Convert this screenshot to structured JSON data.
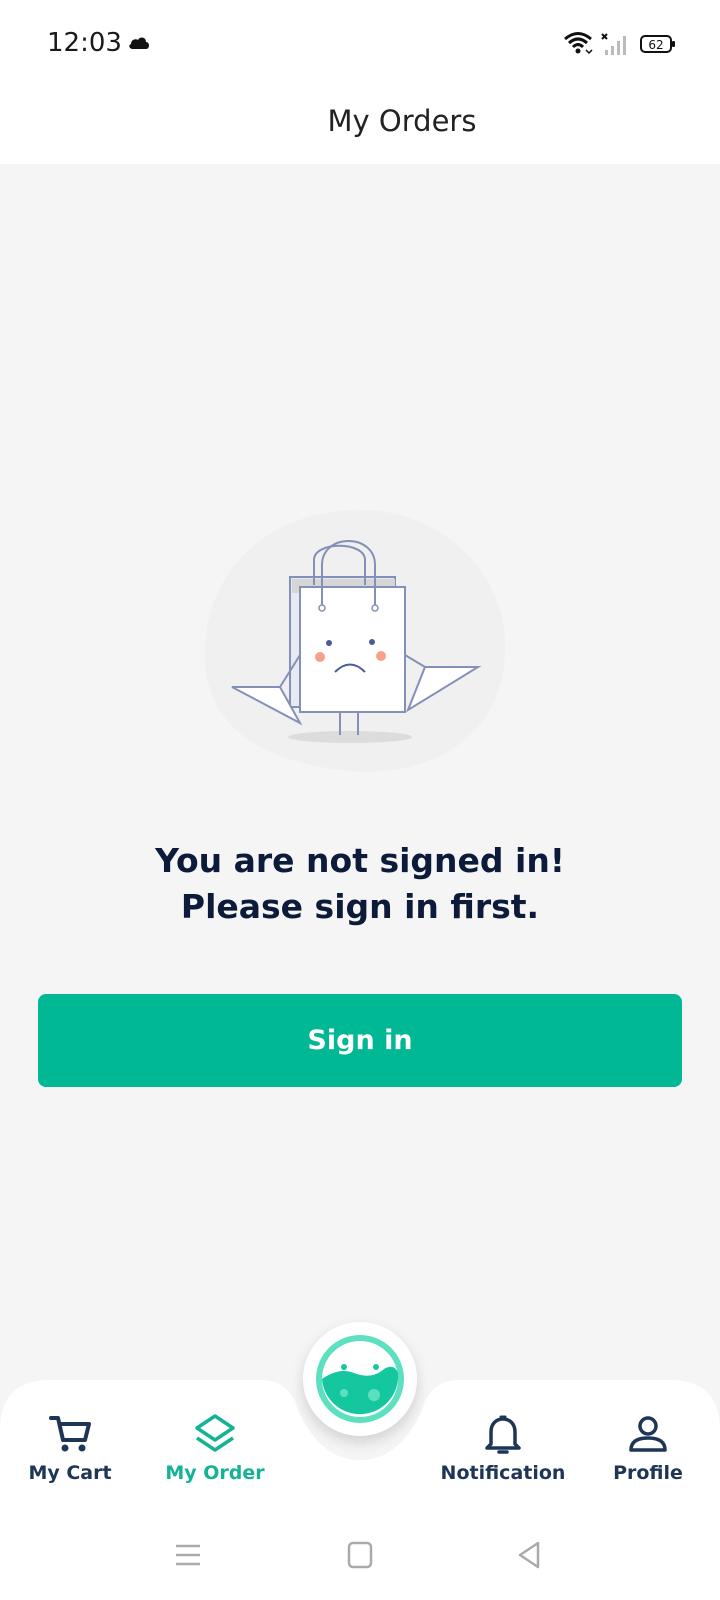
{
  "status_bar": {
    "time": "12:03",
    "battery_level": "62",
    "icons": [
      "cloud-icon",
      "wifi-icon",
      "signal-icon",
      "battery-icon"
    ]
  },
  "header": {
    "title": "My Orders"
  },
  "main": {
    "illustration": "sad-shopping-bag-illustration",
    "message_line1": "You are not signed in!",
    "message_line2": "Please sign in first.",
    "signin_label": "Sign in"
  },
  "bottom_nav": {
    "items": [
      {
        "label": "My Cart",
        "icon": "cart-icon",
        "active": false
      },
      {
        "label": "My Order",
        "icon": "layers-icon",
        "active": true
      },
      {
        "label": "Notification",
        "icon": "bell-icon",
        "active": false
      },
      {
        "label": "Profile",
        "icon": "person-icon",
        "active": false
      }
    ],
    "center_icon": "flask-icon"
  },
  "system_nav": {
    "icons": [
      "menu-icon",
      "home-icon",
      "back-icon"
    ]
  },
  "colors": {
    "accent": "#00b894",
    "dark_text": "#0d1b3a",
    "nav_text": "#1f3556",
    "background": "#f5f5f5"
  }
}
